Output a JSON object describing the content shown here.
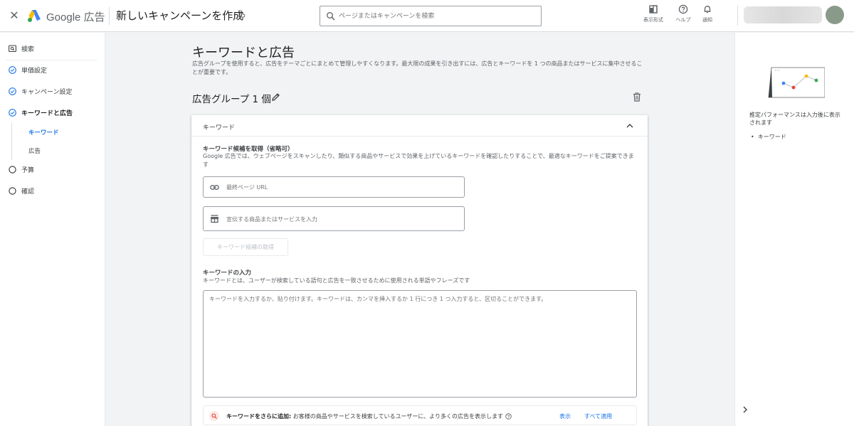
{
  "header": {
    "brand": "Google 広告",
    "campaign_title": "新しいキャンペーンを作成",
    "search_placeholder": "ページまたはキャンペーンを検索",
    "tools": [
      {
        "label": "表示形式",
        "icon": "display-format-icon"
      },
      {
        "label": "ヘルプ",
        "icon": "help-icon"
      },
      {
        "label": "通知",
        "icon": "bell-icon"
      }
    ]
  },
  "sidebar": {
    "items": [
      {
        "label": "検索",
        "icon": "search-box-icon"
      },
      {
        "label": "単価設定",
        "icon": "check-circle-icon"
      },
      {
        "label": "キャンペーン設定",
        "icon": "check-circle-icon"
      },
      {
        "label": "キーワードと広告",
        "icon": "check-circle-icon"
      },
      {
        "label": "予算",
        "icon": "empty-circle-icon"
      },
      {
        "label": "確認",
        "icon": "empty-circle-icon"
      }
    ],
    "sub_items": [
      {
        "label": "キーワード",
        "active": true
      },
      {
        "label": "広告",
        "active": false
      }
    ]
  },
  "main": {
    "title": "キーワードと広告",
    "description": "広告グループを使用すると、広告をテーマごとにまとめて管理しやすくなります。最大限の成果を引き出すには、広告とキーワードを 1 つの商品またはサービスに集中させることが重要です。",
    "group_title": "広告グループ 1 個",
    "card": {
      "header": "キーワード",
      "suggest_title": "キーワード候補を取得（省略可）",
      "suggest_desc": "Google 広告では、ウェブページをスキャンしたり、類似する商品やサービスで効果を上げているキーワードを確認したりすることで、最適なキーワードをご提案できます",
      "url_placeholder": "最終ページ URL",
      "product_placeholder": "宣伝する商品またはサービスを入力",
      "get_button": "キーワード候補の取得",
      "input_title": "キーワードの入力",
      "input_desc": "キーワードとは、ユーザーが検索している語句と広告を一致させるために使用される単語やフレーズです",
      "textarea_placeholder": "キーワードを入力するか、貼り付けます。キーワードは、カンマを挿入するか 1 行につき 1 つ入力すると、区切ることができます。",
      "more_bold": "キーワードをさらに追加:",
      "more_text": " お客様の商品やサービスを検索しているユーザーに、より多くの広告を表示します",
      "show_link": "表示",
      "apply_all_link": "すべて適用"
    }
  },
  "right_panel": {
    "perf_text": "推定パフォーマンスは入力後に表示されます",
    "bullet": "キーワード"
  },
  "colors": {
    "accent": "#1a73e8",
    "text": "#202124",
    "muted": "#5f6368",
    "logo_blue": "#4285f4",
    "logo_yellow": "#fbbc04",
    "logo_green": "#34a853"
  }
}
